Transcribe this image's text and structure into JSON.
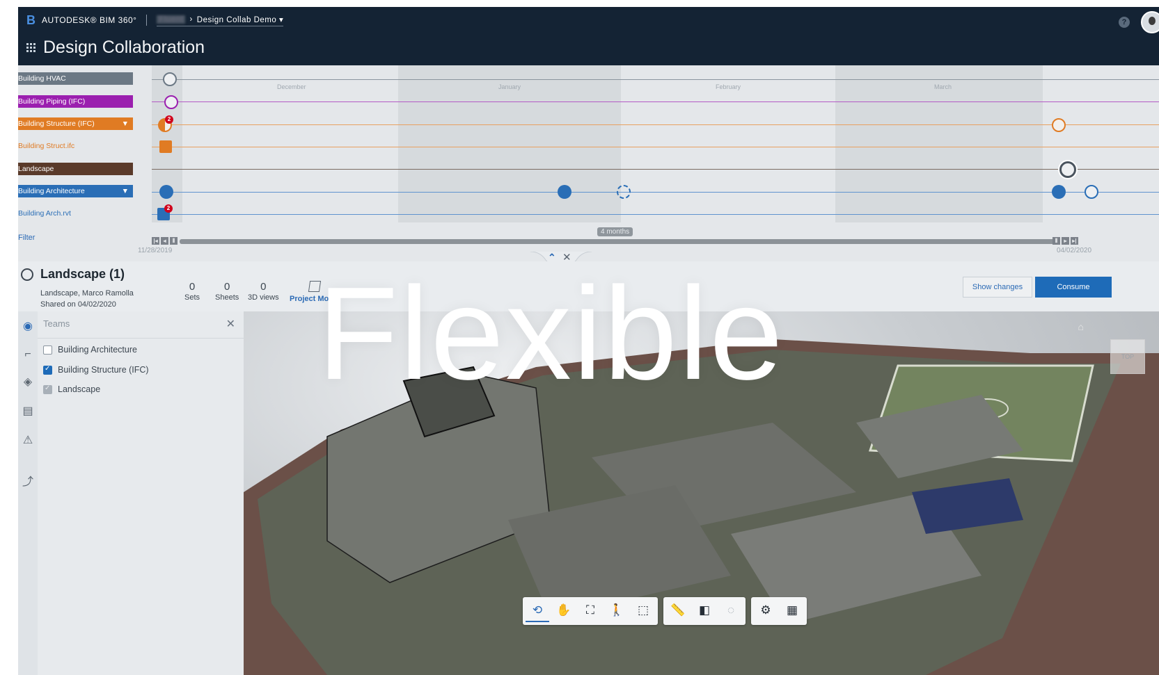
{
  "header": {
    "brand": "AUTODESK® BIM 360°",
    "breadcrumb_hidden": "Fluent",
    "breadcrumb_sep": "›",
    "project": "Design Collab Demo ▾",
    "page_title": "Design Collaboration",
    "help": "?"
  },
  "timeline": {
    "tracks": [
      {
        "label": "Building HVAC",
        "color": "#6b7884",
        "style": "fill"
      },
      {
        "label": "Building Piping (IFC)",
        "color": "#9b1faf",
        "style": "fill"
      },
      {
        "label": "Building Structure (IFC)",
        "color": "#e07b23",
        "style": "fill",
        "caret": "▼"
      },
      {
        "label": "Building Struct.ifc",
        "color": "#e07b23",
        "style": "text"
      },
      {
        "label": "Landscape",
        "color": "#5a3a2a",
        "style": "fill"
      },
      {
        "label": "Building Architecture",
        "color": "#2a6eb6",
        "style": "fill",
        "caret": "▼"
      },
      {
        "label": "Building Arch.rvt",
        "color": "#2a6eb6",
        "style": "text"
      }
    ],
    "months": [
      "December",
      "January",
      "February",
      "March"
    ],
    "filter": "Filter",
    "range": "4 months",
    "date_start": "11/28/2019",
    "date_end": "04/02/2020",
    "badges": [
      "2",
      "2"
    ]
  },
  "package": {
    "title": "Landscape (1)",
    "subtitle": "Landscape, Marco Ramolla",
    "shared": "Shared on 04/02/2020",
    "stats": [
      {
        "value": "0",
        "label": "Sets"
      },
      {
        "value": "0",
        "label": "Sheets"
      },
      {
        "value": "0",
        "label": "3D views"
      }
    ],
    "project_model": "Project Mo",
    "show_changes": "Show changes",
    "consume": "Consume"
  },
  "teams": {
    "title": "Teams",
    "close": "✕",
    "items": [
      {
        "label": "Building Architecture",
        "state": "off"
      },
      {
        "label": "Building Structure (IFC)",
        "state": "on"
      },
      {
        "label": "Landscape",
        "state": "dim"
      }
    ]
  },
  "overlay": {
    "word": "Flexible"
  },
  "toolbar": {
    "icons": [
      "orbit-icon",
      "pan-icon",
      "fit-icon",
      "walk-icon",
      "zoom-window-icon",
      "measure-icon",
      "section-icon",
      "hide-icon",
      "settings-icon",
      "properties-icon"
    ]
  }
}
